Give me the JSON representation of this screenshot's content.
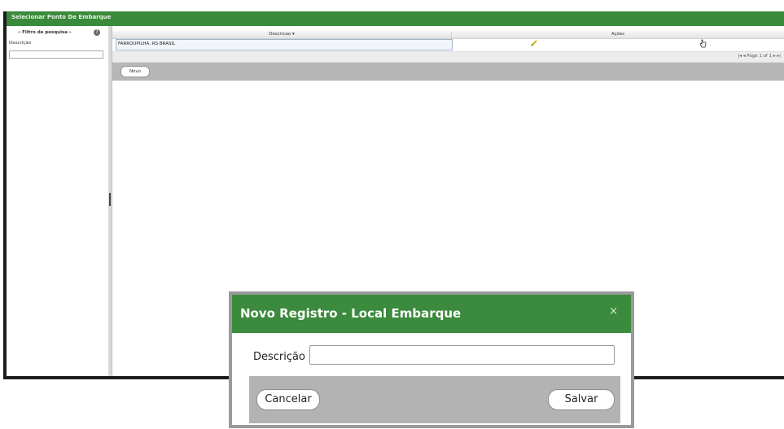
{
  "window": {
    "title": "Selecionar Ponto De Embarque"
  },
  "sidebar": {
    "filter_title": "Filtro de pesquisa",
    "field_label": "Descrição",
    "field_value": ""
  },
  "grid": {
    "columns": [
      "Descricao",
      "Ações"
    ],
    "rows": [
      {
        "descricao": "FARROUPILHA, RS BRASIL"
      }
    ],
    "pager": {
      "text": "Page 1 of 1"
    }
  },
  "toolbar": {
    "new_label": "Novo"
  },
  "modal": {
    "title": "Novo Registro - Local Embarque",
    "close_glyph": "×",
    "field_label": "Descrição",
    "field_value": "",
    "cancel_label": "Cancelar",
    "save_label": "Salvar"
  },
  "colors": {
    "header_green": "#3a8a3b",
    "modal_green": "#3b8a3d",
    "footer_gray": "#b3b3b3"
  },
  "icons": [
    "help-icon",
    "pencil-icon",
    "hand-pointer-icon",
    "close-icon"
  ]
}
